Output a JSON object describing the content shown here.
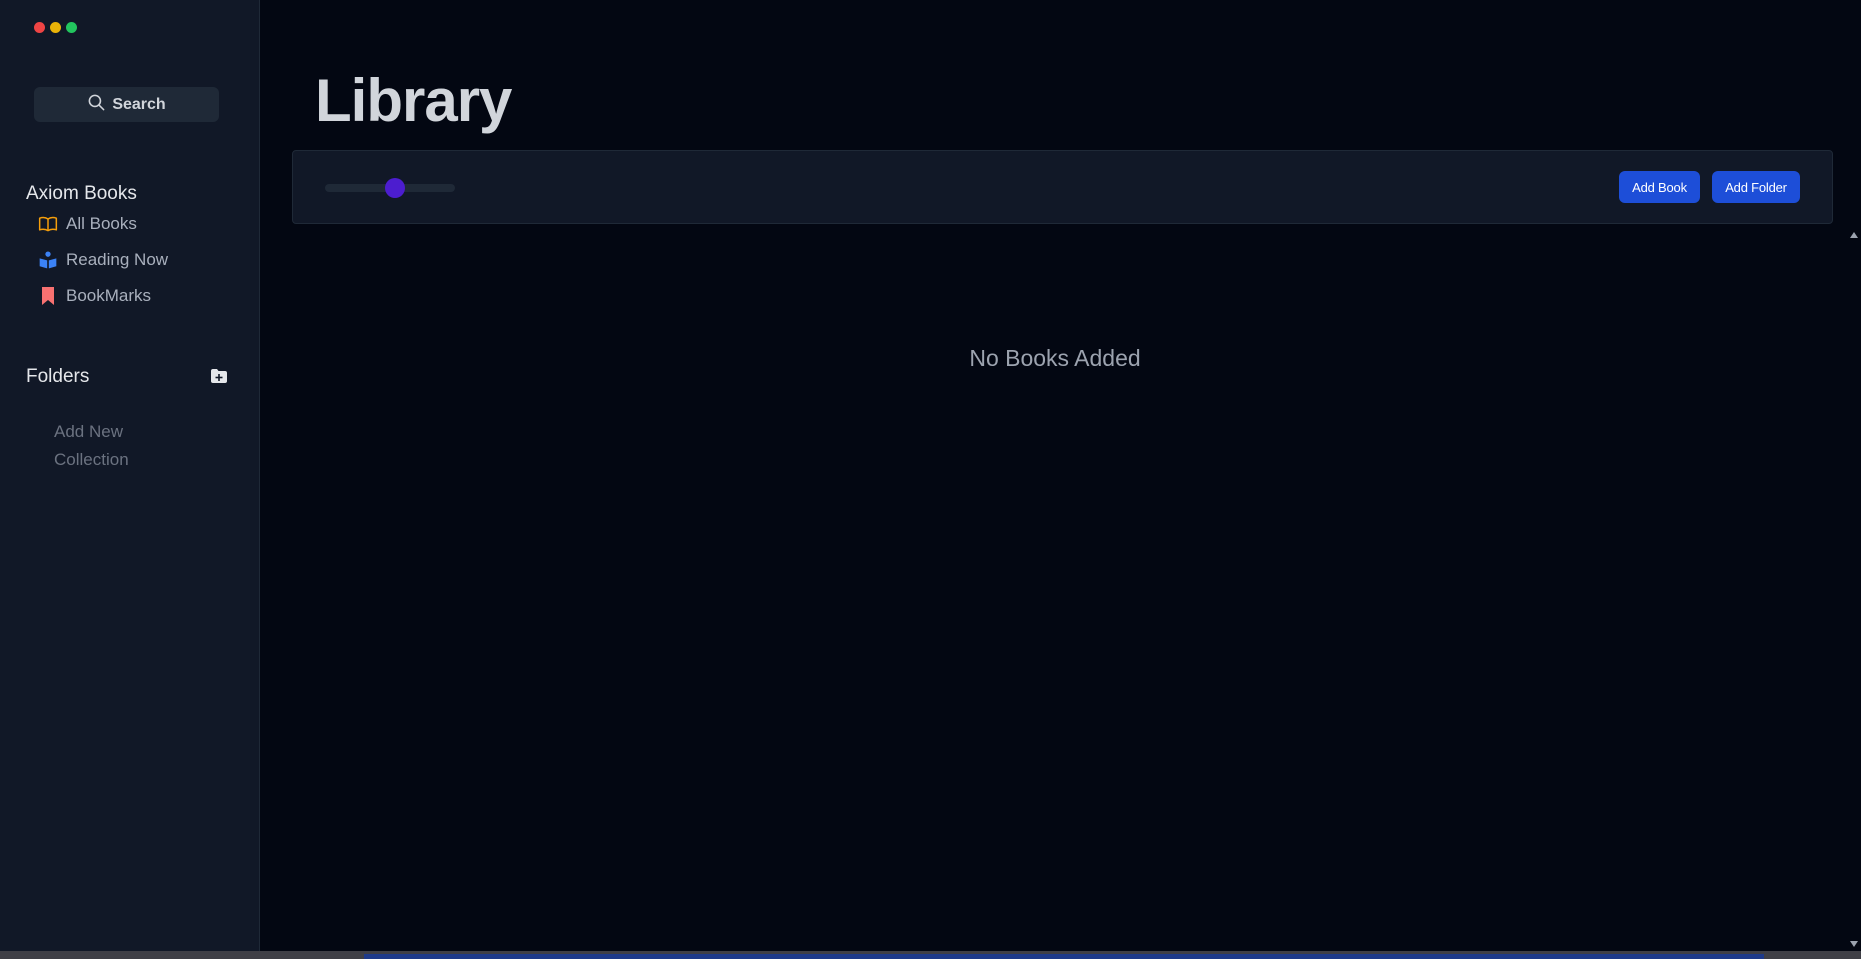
{
  "sidebar": {
    "search_label": "Search",
    "library_section": "Axiom Books",
    "items": [
      {
        "label": "All Books",
        "icon": "open-book-icon",
        "color": "#f59e0b"
      },
      {
        "label": "Reading Now",
        "icon": "reader-icon",
        "color": "#3b82f6"
      },
      {
        "label": "BookMarks",
        "icon": "bookmark-icon",
        "color": "#f87171"
      }
    ],
    "folders_title": "Folders",
    "add_collection_label": "Add New Collection"
  },
  "main": {
    "title": "Library",
    "toolbar": {
      "zoom_slider_value": 0.54,
      "add_book_label": "Add Book",
      "add_folder_label": "Add Folder"
    },
    "empty_message": "No Books Added"
  },
  "colors": {
    "accent": "#1d4ed8",
    "slider_thumb": "#4c1dcf",
    "sidebar_bg": "#111827",
    "main_bg": "#030712"
  }
}
